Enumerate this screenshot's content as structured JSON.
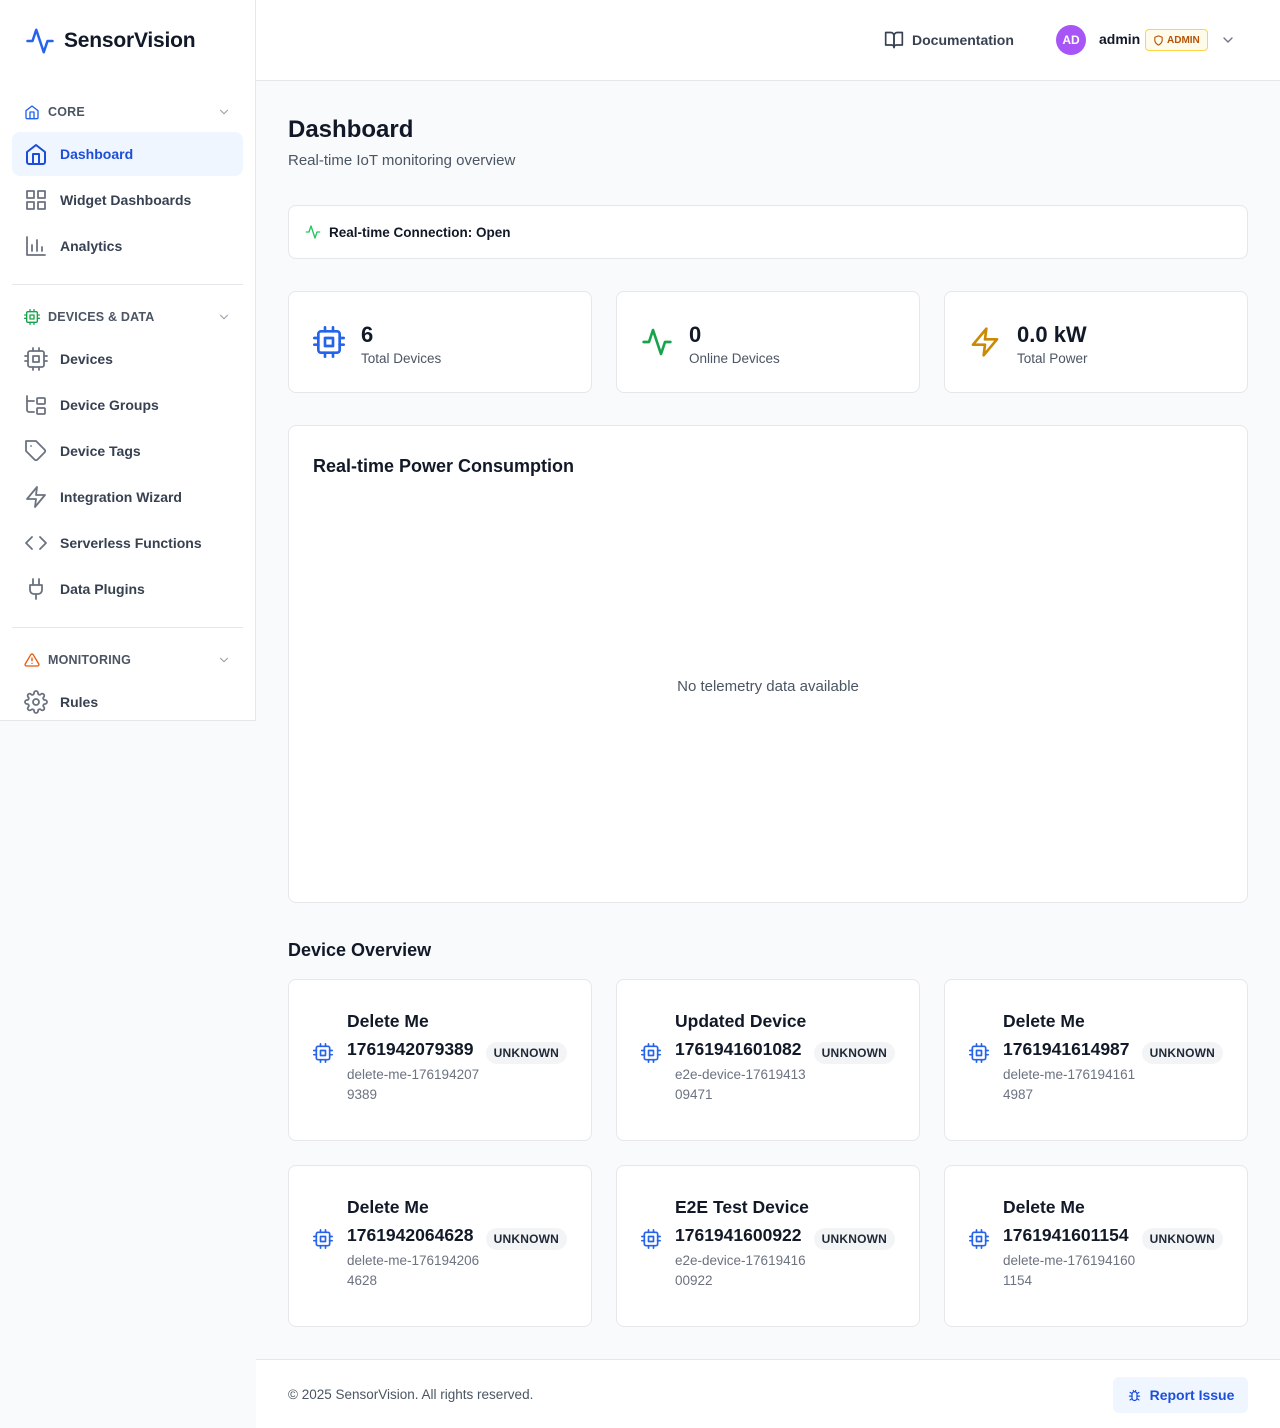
{
  "app": {
    "name": "SensorVision"
  },
  "sidebar": {
    "sections": [
      {
        "label": "CORE",
        "items": [
          {
            "label": "Dashboard"
          },
          {
            "label": "Widget Dashboards"
          },
          {
            "label": "Analytics"
          }
        ]
      },
      {
        "label": "DEVICES & DATA",
        "items": [
          {
            "label": "Devices"
          },
          {
            "label": "Device Groups"
          },
          {
            "label": "Device Tags"
          },
          {
            "label": "Integration Wizard"
          },
          {
            "label": "Serverless Functions"
          },
          {
            "label": "Data Plugins"
          }
        ]
      },
      {
        "label": "MONITORING",
        "items": [
          {
            "label": "Rules"
          }
        ]
      }
    ]
  },
  "header": {
    "documentation_label": "Documentation",
    "avatar_initials": "AD",
    "username": "admin",
    "role": "ADMIN"
  },
  "page": {
    "title": "Dashboard",
    "subtitle": "Real-time IoT monitoring overview"
  },
  "connection": {
    "label": "Real-time Connection: Open"
  },
  "stats": [
    {
      "value": "6",
      "caption": "Total Devices",
      "color": "#2563eb",
      "icon": "cpu-icon"
    },
    {
      "value": "0",
      "caption": "Online Devices",
      "color": "#16a34a",
      "icon": "activity-icon"
    },
    {
      "value": "0.0 kW",
      "caption": "Total Power",
      "color": "#ca8a04",
      "icon": "zap-icon"
    }
  ],
  "chart": {
    "title": "Real-time Power Consumption",
    "empty_message": "No telemetry data available"
  },
  "device_overview": {
    "title": "Device Overview",
    "devices": [
      {
        "name": "Delete Me 1761942079389",
        "slug": "delete-me-1761942079389",
        "status": "UNKNOWN"
      },
      {
        "name": "Updated Device 1761941601082",
        "slug": "e2e-device-1761941309471",
        "status": "UNKNOWN"
      },
      {
        "name": "Delete Me 1761941614987",
        "slug": "delete-me-1761941614987",
        "status": "UNKNOWN"
      },
      {
        "name": "Delete Me 1761942064628",
        "slug": "delete-me-1761942064628",
        "status": "UNKNOWN"
      },
      {
        "name": "E2E Test Device 1761941600922",
        "slug": "e2e-device-1761941600922",
        "status": "UNKNOWN"
      },
      {
        "name": "Delete Me 1761941601154",
        "slug": "delete-me-1761941601154",
        "status": "UNKNOWN"
      }
    ]
  },
  "footer": {
    "copyright": "© 2025 SensorVision. All rights reserved.",
    "report_label": "Report Issue"
  },
  "colors": {
    "accent": "#2563eb",
    "active_bg": "#eff6ff",
    "admin_badge": "#b45309",
    "avatar": "#a855f7",
    "monitoring": "#ea580c",
    "devices_section": "#16a34a"
  }
}
